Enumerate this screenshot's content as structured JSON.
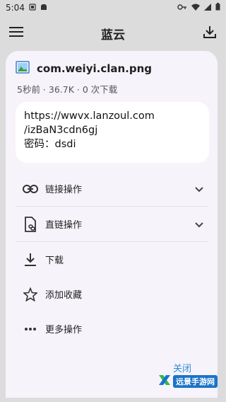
{
  "status_bar": {
    "time": "5:04"
  },
  "app_bar": {
    "title": "蓝云"
  },
  "file": {
    "name": "com.weiyi.clan.png",
    "meta": "5秒前 · 36.7K · 0 次下载"
  },
  "link_box": {
    "url_line1": "https://wwvx.lanzoul.com",
    "url_line2": "/izBaN3cdn6gj",
    "password": "密码：dsdi"
  },
  "menu": {
    "items": [
      {
        "label": "链接操作",
        "icon": "link-icon",
        "expandable": true
      },
      {
        "label": "直链操作",
        "icon": "direct-link-file-icon",
        "expandable": true
      },
      {
        "label": "下载",
        "icon": "download-icon",
        "expandable": false
      },
      {
        "label": "添加收藏",
        "icon": "star-icon",
        "expandable": false
      },
      {
        "label": "更多操作",
        "icon": "more-horizontal-icon",
        "expandable": false
      }
    ]
  },
  "actions": {
    "close_label": "关闭"
  },
  "watermark": {
    "text": "远景手游网"
  },
  "colors": {
    "accent": "#2d8bd9",
    "sheet_bg": "#f7f3fa",
    "backdrop": "#dcdcdc"
  }
}
